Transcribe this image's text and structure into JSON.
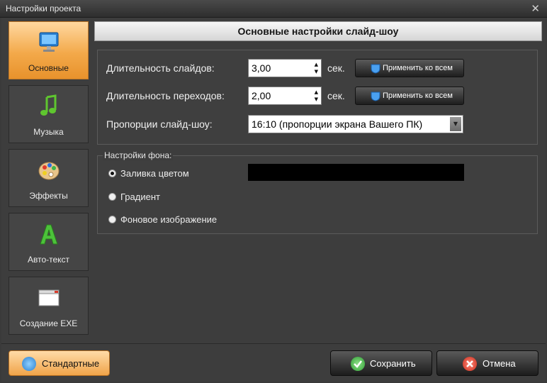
{
  "window": {
    "title": "Настройки проекта",
    "close_glyph": "✕"
  },
  "sidebar": {
    "items": [
      {
        "label": "Основные",
        "icon": "monitor-icon"
      },
      {
        "label": "Музыка",
        "icon": "music-note-icon"
      },
      {
        "label": "Эффекты",
        "icon": "palette-icon"
      },
      {
        "label": "Авто-текст",
        "icon": "letter-a-icon"
      },
      {
        "label": "Создание EXE",
        "icon": "window-icon"
      }
    ]
  },
  "header": {
    "title": "Основные настройки слайд-шоу"
  },
  "settings": {
    "slide_duration": {
      "label": "Длительность слайдов:",
      "value": "3,00",
      "unit": "сек.",
      "apply": "Применить ко всем"
    },
    "transition_duration": {
      "label": "Длительность переходов:",
      "value": "2,00",
      "unit": "сек.",
      "apply": "Применить ко всем"
    },
    "aspect_ratio": {
      "label": "Пропорции слайд-шоу:",
      "value": "16:10  (пропорции экрана Вашего ПК)"
    }
  },
  "background": {
    "legend": "Настройки фона:",
    "options": [
      {
        "label": "Заливка цветом",
        "selected": true
      },
      {
        "label": "Градиент",
        "selected": false
      },
      {
        "label": "Фоновое изображение",
        "selected": false
      }
    ],
    "fill_color": "#000000"
  },
  "footer": {
    "defaults_label": "Стандартные",
    "save_label": "Сохранить",
    "cancel_label": "Отмена"
  },
  "colors": {
    "accent": "#f3a94a",
    "ok": "#3cb64a",
    "cancel": "#d83a2a"
  }
}
